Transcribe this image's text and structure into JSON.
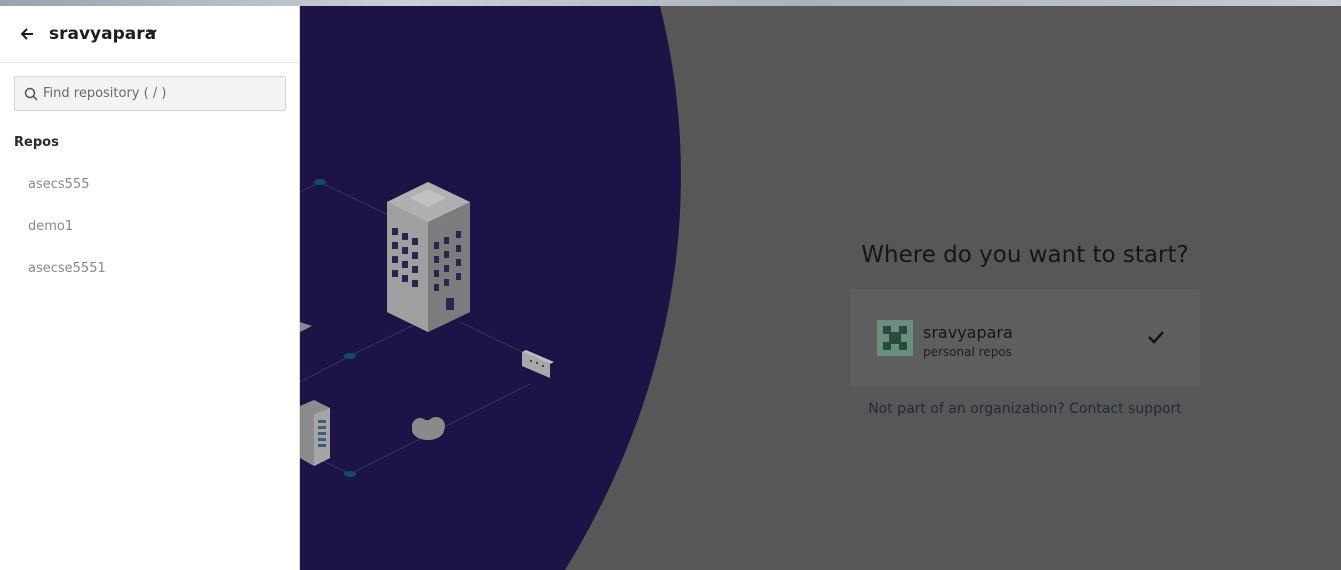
{
  "sidebar": {
    "account_name": "sravyapara",
    "search": {
      "placeholder": "Find repository ( / )",
      "value": ""
    },
    "section_title": "Repos",
    "repos": [
      {
        "label": "asecs555"
      },
      {
        "label": "demo1"
      },
      {
        "label": "asecse5551"
      }
    ]
  },
  "main": {
    "heading": "Where do you want to start?",
    "org": {
      "name": "sravyapara",
      "subtitle": "personal repos",
      "selected": true
    },
    "contact_text": "Not part of an organization? Contact support"
  },
  "icons": {
    "back": "arrow-left-icon",
    "chevron": "chevron-down-icon",
    "search": "search-icon",
    "check": "check-icon"
  },
  "colors": {
    "illustration_bg": "#1c1446",
    "overlay_gray": "#575757",
    "sidebar_bg": "#ffffff"
  }
}
